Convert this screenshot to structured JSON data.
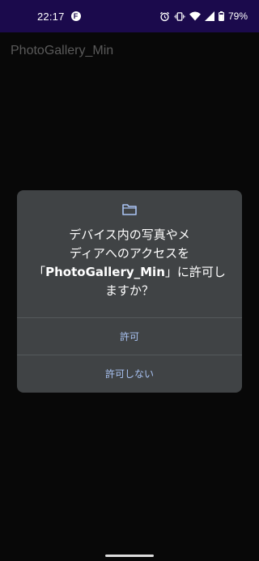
{
  "status_bar": {
    "time": "22:17",
    "app_icon_letter": "F",
    "battery": "79%"
  },
  "app": {
    "title": "PhotoGallery_Min"
  },
  "dialog": {
    "icon": "folder-icon",
    "message_line1": "デバイス内の写真やメ",
    "message_line2": "ディアへのアクセスを",
    "message_bracket_open": "「",
    "message_app_name": "PhotoGallery_Min",
    "message_bracket_close_suffix": "」に許可し",
    "message_line4": "ますか？",
    "allow_label": "許可",
    "deny_label": "許可しない"
  },
  "colors": {
    "status_bar_bg": "#1b0a4c",
    "screen_bg": "#080808",
    "dialog_bg": "#404345",
    "button_text": "#a9c3f3"
  }
}
